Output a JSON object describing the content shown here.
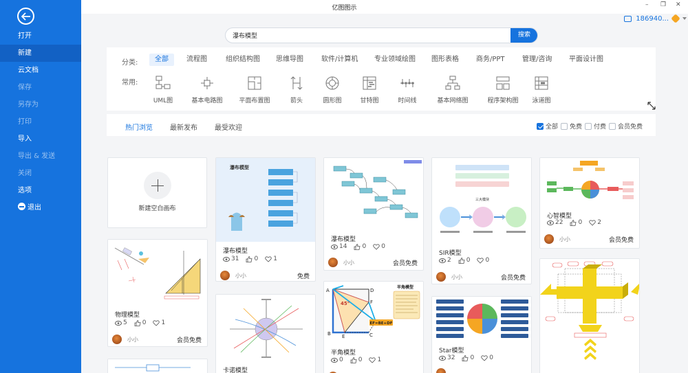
{
  "window": {
    "title": "亿图图示",
    "min_glyph": "–",
    "restore_glyph": "❐",
    "close_glyph": "✕"
  },
  "account": {
    "user": "186940..."
  },
  "sidebar": {
    "items": [
      {
        "label": "打开",
        "state": "normal"
      },
      {
        "label": "新建",
        "state": "active"
      },
      {
        "label": "云文档",
        "state": "normal"
      },
      {
        "label": "保存",
        "state": "dim"
      },
      {
        "label": "另存为",
        "state": "dim"
      },
      {
        "label": "打印",
        "state": "dim"
      },
      {
        "label": "导入",
        "state": "normal"
      },
      {
        "label": "导出 & 发送",
        "state": "dim"
      },
      {
        "label": "关闭",
        "state": "dim"
      },
      {
        "label": "选项",
        "state": "normal"
      },
      {
        "label": "退出",
        "state": "normal"
      }
    ]
  },
  "search": {
    "value": "瀑布模型",
    "button": "搜索"
  },
  "categories": {
    "label": "分类:",
    "items": [
      "全部",
      "流程图",
      "组织结构图",
      "思维导图",
      "软件/计算机",
      "专业领域绘图",
      "图形表格",
      "商务/PPT",
      "管理/咨询",
      "平面设计图"
    ],
    "active": 0
  },
  "common": {
    "label": "常用:",
    "items": [
      "UML图",
      "基本电路图",
      "平面布置图",
      "箭头",
      "圆形图",
      "甘特图",
      "时间线",
      "基本网络图",
      "程序架构图",
      "泳道图"
    ]
  },
  "tabs": {
    "items": [
      "热门浏览",
      "最新发布",
      "最受欢迎"
    ],
    "active": 0
  },
  "filters": [
    {
      "label": "全部",
      "checked": true
    },
    {
      "label": "免费",
      "checked": false
    },
    {
      "label": "付费",
      "checked": false
    },
    {
      "label": "会员免费",
      "checked": false
    }
  ],
  "blank_card": {
    "label": "新建空白画布"
  },
  "cards": [
    {
      "title": "瀑布模型",
      "views": "31",
      "likes": "0",
      "favs": "1",
      "author": "小小",
      "price": "免费"
    },
    {
      "title": "瀑布模型",
      "views": "14",
      "likes": "0",
      "favs": "0",
      "author": "小小",
      "price": "会员免费"
    },
    {
      "title": "SIR模型",
      "views": "2",
      "likes": "0",
      "favs": "0",
      "author": "小小",
      "price": "会员免费"
    },
    {
      "title": "心智模型",
      "views": "22",
      "likes": "0",
      "favs": "2",
      "author": "小小",
      "price": "会员免费"
    },
    {
      "title": "物理模型",
      "views": "5",
      "likes": "0",
      "favs": "1",
      "author": "小小",
      "price": "会员免费"
    },
    {
      "title": "半角模型",
      "views": "0",
      "likes": "0",
      "favs": "1"
    },
    {
      "title": "Star模型",
      "views": "32",
      "likes": "0",
      "favs": "0"
    },
    {
      "title": "卡诺模型"
    }
  ],
  "thumbs": {
    "waterfall": "瀑布模型",
    "halfangle": "半角模型",
    "formula": "EF=BE+DF",
    "sir_caption": "三大模块",
    "pts": {
      "A": "A",
      "B": "B",
      "C": "C",
      "D": "D",
      "E": "E",
      "F": "F"
    },
    "angle": "45°"
  }
}
